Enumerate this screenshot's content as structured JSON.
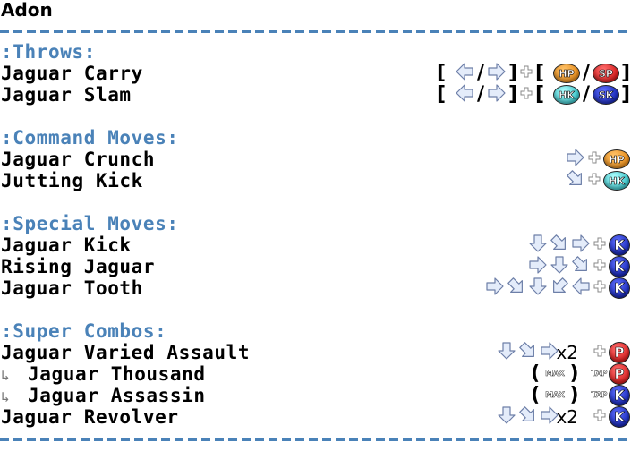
{
  "character": "Adon",
  "sections": [
    {
      "title": ":Throws:",
      "moves": [
        {
          "name": "Jaguar Carry",
          "input": [
            "[",
            "back",
            "/",
            "forward",
            "]",
            "plus",
            "[",
            "HP",
            "/",
            "SP",
            "]"
          ]
        },
        {
          "name": "Jaguar Slam",
          "input": [
            "[",
            "back",
            "/",
            "forward",
            "]",
            "plus",
            "[",
            "HK",
            "/",
            "SK",
            "]"
          ]
        }
      ]
    },
    {
      "title": ":Command Moves:",
      "moves": [
        {
          "name": "Jaguar Crunch",
          "input": [
            "forward",
            "plus",
            "HP"
          ]
        },
        {
          "name": "Jutting Kick",
          "input": [
            "down-forward",
            "plus",
            "HK"
          ]
        }
      ]
    },
    {
      "title": ":Special Moves:",
      "moves": [
        {
          "name": "Jaguar Kick",
          "input": [
            "down",
            "down-forward",
            "forward",
            "plus",
            "K"
          ]
        },
        {
          "name": "Rising Jaguar",
          "input": [
            "forward",
            "down",
            "down-forward",
            "plus",
            "K"
          ]
        },
        {
          "name": "Jaguar Tooth",
          "input": [
            "forward",
            "down-forward",
            "down",
            "down-back",
            "back",
            "plus",
            "K"
          ]
        }
      ]
    },
    {
      "title": ":Super Combos:",
      "moves": [
        {
          "name": "Jaguar Varied Assault",
          "input": [
            "down",
            "down-forward",
            "forward",
            "x2",
            "plus",
            "P"
          ]
        },
        {
          "name": "Jaguar Thousand",
          "sub": true,
          "input": [
            "(",
            "MAX",
            ")",
            "TAP",
            "P"
          ]
        },
        {
          "name": "Jaguar Assassin",
          "sub": true,
          "input": [
            "(",
            "MAX",
            ")",
            "TAP",
            "K"
          ]
        },
        {
          "name": "Jaguar Revolver",
          "input": [
            "down",
            "down-forward",
            "forward",
            "x2",
            "plus",
            "K"
          ]
        }
      ]
    }
  ],
  "button_colors": {
    "HP": "orange",
    "SP": "red",
    "HK": "cyan",
    "SK": "blue",
    "P": "red",
    "K": "blue"
  },
  "labels": {
    "sub_arrow": "↳"
  }
}
